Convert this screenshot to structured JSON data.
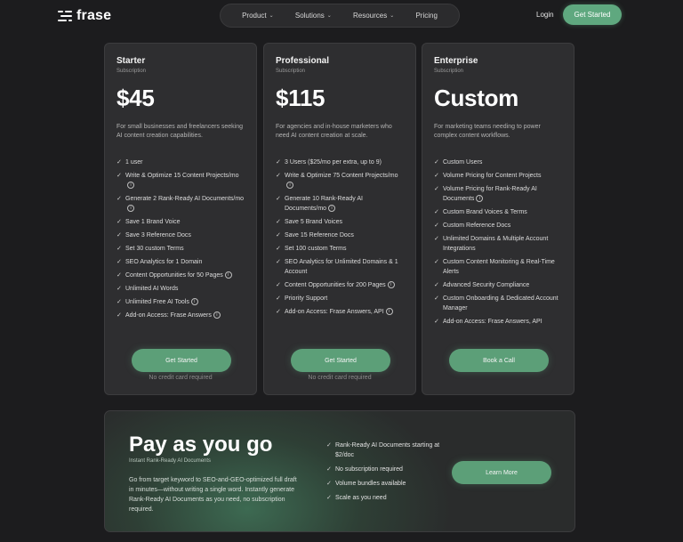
{
  "header": {
    "logo": "frase",
    "nav": [
      {
        "label": "Product",
        "dropdown": true
      },
      {
        "label": "Solutions",
        "dropdown": true
      },
      {
        "label": "Resources",
        "dropdown": true
      },
      {
        "label": "Pricing",
        "dropdown": false
      }
    ],
    "login": "Login",
    "cta": "Get Started"
  },
  "plans": [
    {
      "name": "Starter",
      "sub": "Subscription",
      "price": "$45",
      "desc": "For small businesses and freelancers seeking AI content creation capabilities.",
      "features": [
        {
          "text": "1 user",
          "info": false
        },
        {
          "text": "Write & Optimize 15 Content Projects/mo",
          "info": true
        },
        {
          "text": "Generate 2 Rank-Ready AI Documents/mo",
          "info": true
        },
        {
          "text": "Save 1 Brand Voice",
          "info": false
        },
        {
          "text": "Save 3 Reference Docs",
          "info": false
        },
        {
          "text": "Set 30 custom Terms",
          "info": false
        },
        {
          "text": "SEO Analytics for 1 Domain",
          "info": false
        },
        {
          "text": "Content Opportunities for 50 Pages",
          "info": true
        },
        {
          "text": "Unlimited AI Words",
          "info": false
        },
        {
          "text": "Unlimited Free AI Tools",
          "info": true
        },
        {
          "text": "Add-on Access: Frase Answers",
          "info": true
        }
      ],
      "button": "Get Started",
      "note": "No credit card required"
    },
    {
      "name": "Professional",
      "sub": "Subscription",
      "price": "$115",
      "desc": "For agencies and in-house marketers who need AI content creation at scale.",
      "features": [
        {
          "text": "3 Users ($25/mo per extra, up to 9)",
          "info": false
        },
        {
          "text": "Write & Optimize 75 Content Projects/mo",
          "info": true
        },
        {
          "text": "Generate 10 Rank-Ready AI Documents/mo",
          "info": true
        },
        {
          "text": "Save 5 Brand Voices",
          "info": false
        },
        {
          "text": "Save 15 Reference Docs",
          "info": false
        },
        {
          "text": "Set 100 custom Terms",
          "info": false
        },
        {
          "text": "SEO Analytics for Unlimited Domains & 1 Account",
          "info": false
        },
        {
          "text": "Content Opportunities for 200 Pages",
          "info": true
        },
        {
          "text": "Priority Support",
          "info": false
        },
        {
          "text": "Add-on Access: Frase Answers, API",
          "info": true
        }
      ],
      "button": "Get Started",
      "note": "No credit card required"
    },
    {
      "name": "Enterprise",
      "sub": "Subscription",
      "price": "Custom",
      "desc": "For marketing teams needing to power complex content workflows.",
      "features": [
        {
          "text": "Custom Users",
          "info": false
        },
        {
          "text": "Volume Pricing for Content Projects",
          "info": false
        },
        {
          "text": "Volume Pricing for Rank-Ready AI Documents",
          "info": true
        },
        {
          "text": "Custom Brand Voices & Terms",
          "info": false
        },
        {
          "text": "Custom Reference Docs",
          "info": false
        },
        {
          "text": "Unlimited Domains & Multiple Account Integrations",
          "info": false
        },
        {
          "text": "Custom Content Monitoring & Real-Time Alerts",
          "info": false
        },
        {
          "text": "Advanced Security Compliance",
          "info": false
        },
        {
          "text": "Custom Onboarding & Dedicated Account Manager",
          "info": false
        },
        {
          "text": "Add-on Access: Frase Answers, API",
          "info": false
        }
      ],
      "button": "Book a Call",
      "note": ""
    }
  ],
  "payg": {
    "title": "Pay as you go",
    "sub": "Instant Rank-Ready AI Documents",
    "desc": "Go from target keyword to SEO-and-GEO-optimized full draft in minutes—without writing a single word. Instantly generate Rank-Ready AI Documents as you need, no subscription required.",
    "features": [
      "Rank-Ready AI Documents starting at $2/doc",
      "No subscription required",
      "Volume bundles available",
      "Scale as you need"
    ],
    "button": "Learn More"
  }
}
